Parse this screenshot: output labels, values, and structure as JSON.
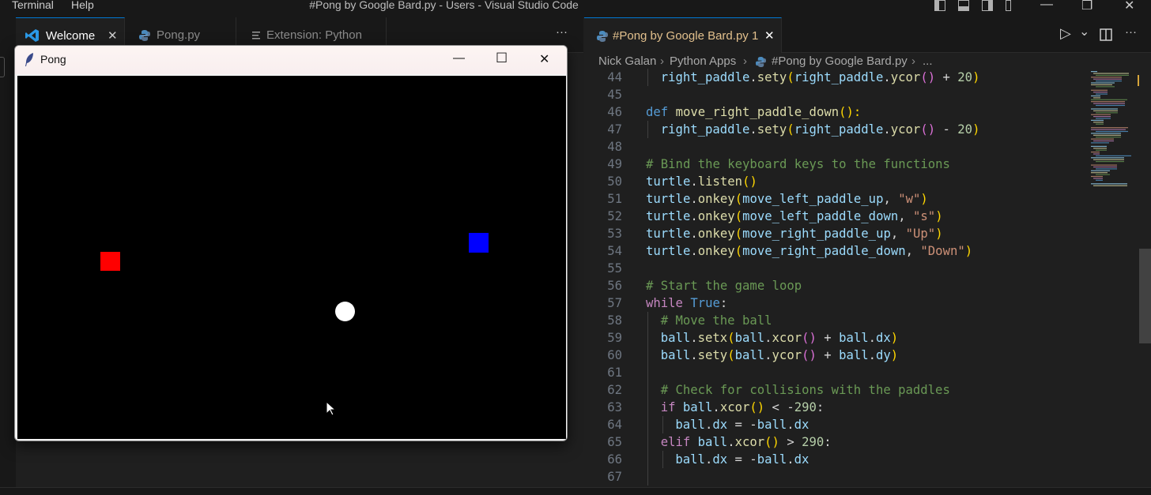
{
  "titlebar": {
    "menu": [
      "Terminal",
      "Help"
    ],
    "title": "#Pong by Google Bard.py - Users - Visual Studio Code",
    "controls": {
      "minimize": "—",
      "maximize": "❐",
      "close": "✕"
    }
  },
  "left_tabs": [
    {
      "label": "Welcome",
      "icon": "vscode-logo-icon",
      "close": "✕"
    },
    {
      "label": "Pong.py",
      "icon": "python-icon"
    },
    {
      "label": "Extension: Python",
      "icon": "extension-icon"
    }
  ],
  "left_more": "···",
  "pong_window": {
    "title": "Pong",
    "icon": "feather-icon",
    "controls": {
      "minimize": "—",
      "maximize": "☐",
      "close": "✕"
    },
    "colors": {
      "left_paddle": "#ff0000",
      "right_paddle": "#0000ff",
      "ball": "#ffffff",
      "background": "#000000"
    }
  },
  "right_tab": {
    "label": "#Pong by Google Bard.py",
    "badge": "1",
    "close": "✕",
    "icon": "python-icon"
  },
  "right_actions": {
    "run": "▷",
    "run_dropdown": "⌄",
    "split": "▯",
    "more": "···"
  },
  "breadcrumb": [
    "Nick Galan",
    "Python Apps",
    "#Pong by Google Bard.py",
    "..."
  ],
  "code_lines": [
    {
      "n": "44",
      "indent": 1,
      "tokens": [
        [
          "right_paddle",
          "var"
        ],
        [
          ".",
          "op"
        ],
        [
          "sety",
          "fn"
        ],
        [
          "(",
          "p1"
        ],
        [
          "right_paddle",
          "var"
        ],
        [
          ".",
          "op"
        ],
        [
          "ycor",
          "fn"
        ],
        [
          "()",
          "p2"
        ],
        [
          " + ",
          "op"
        ],
        [
          "20",
          "num"
        ],
        [
          ")",
          "p1"
        ]
      ]
    },
    {
      "n": "45",
      "indent": 0,
      "tokens": []
    },
    {
      "n": "46",
      "indent": 0,
      "tokens": [
        [
          "def ",
          "kw"
        ],
        [
          "move_right_paddle_down",
          "fn"
        ],
        [
          "():",
          "p1"
        ]
      ]
    },
    {
      "n": "47",
      "indent": 1,
      "tokens": [
        [
          "right_paddle",
          "var"
        ],
        [
          ".",
          "op"
        ],
        [
          "sety",
          "fn"
        ],
        [
          "(",
          "p1"
        ],
        [
          "right_paddle",
          "var"
        ],
        [
          ".",
          "op"
        ],
        [
          "ycor",
          "fn"
        ],
        [
          "()",
          "p2"
        ],
        [
          " - ",
          "op"
        ],
        [
          "20",
          "num"
        ],
        [
          ")",
          "p1"
        ]
      ]
    },
    {
      "n": "48",
      "indent": 0,
      "tokens": []
    },
    {
      "n": "49",
      "indent": 0,
      "tokens": [
        [
          "# Bind the keyboard keys to the functions",
          "com"
        ]
      ]
    },
    {
      "n": "50",
      "indent": 0,
      "tokens": [
        [
          "turtle",
          "var"
        ],
        [
          ".",
          "op"
        ],
        [
          "listen",
          "fn"
        ],
        [
          "()",
          "p1"
        ]
      ]
    },
    {
      "n": "51",
      "indent": 0,
      "tokens": [
        [
          "turtle",
          "var"
        ],
        [
          ".",
          "op"
        ],
        [
          "onkey",
          "fn"
        ],
        [
          "(",
          "p1"
        ],
        [
          "move_left_paddle_up",
          "var"
        ],
        [
          ", ",
          "op"
        ],
        [
          "\"w\"",
          "str"
        ],
        [
          ")",
          "p1"
        ]
      ]
    },
    {
      "n": "52",
      "indent": 0,
      "tokens": [
        [
          "turtle",
          "var"
        ],
        [
          ".",
          "op"
        ],
        [
          "onkey",
          "fn"
        ],
        [
          "(",
          "p1"
        ],
        [
          "move_left_paddle_down",
          "var"
        ],
        [
          ", ",
          "op"
        ],
        [
          "\"s\"",
          "str"
        ],
        [
          ")",
          "p1"
        ]
      ]
    },
    {
      "n": "53",
      "indent": 0,
      "tokens": [
        [
          "turtle",
          "var"
        ],
        [
          ".",
          "op"
        ],
        [
          "onkey",
          "fn"
        ],
        [
          "(",
          "p1"
        ],
        [
          "move_right_paddle_up",
          "var"
        ],
        [
          ", ",
          "op"
        ],
        [
          "\"Up\"",
          "str"
        ],
        [
          ")",
          "p1"
        ]
      ]
    },
    {
      "n": "54",
      "indent": 0,
      "tokens": [
        [
          "turtle",
          "var"
        ],
        [
          ".",
          "op"
        ],
        [
          "onkey",
          "fn"
        ],
        [
          "(",
          "p1"
        ],
        [
          "move_right_paddle_down",
          "var"
        ],
        [
          ", ",
          "op"
        ],
        [
          "\"Down\"",
          "str"
        ],
        [
          ")",
          "p1"
        ]
      ]
    },
    {
      "n": "55",
      "indent": 0,
      "tokens": []
    },
    {
      "n": "56",
      "indent": 0,
      "tokens": [
        [
          "# Start the game loop",
          "com"
        ]
      ]
    },
    {
      "n": "57",
      "indent": 0,
      "tokens": [
        [
          "while ",
          "ctl"
        ],
        [
          "True",
          "kw"
        ],
        [
          ":",
          "op"
        ]
      ]
    },
    {
      "n": "58",
      "indent": 1,
      "tokens": [
        [
          "# Move the ball",
          "com"
        ]
      ]
    },
    {
      "n": "59",
      "indent": 1,
      "tokens": [
        [
          "ball",
          "var"
        ],
        [
          ".",
          "op"
        ],
        [
          "setx",
          "fn"
        ],
        [
          "(",
          "p1"
        ],
        [
          "ball",
          "var"
        ],
        [
          ".",
          "op"
        ],
        [
          "xcor",
          "fn"
        ],
        [
          "()",
          "p2"
        ],
        [
          " + ",
          "op"
        ],
        [
          "ball",
          "var"
        ],
        [
          ".",
          "op"
        ],
        [
          "dx",
          "var"
        ],
        [
          ")",
          "p1"
        ]
      ]
    },
    {
      "n": "60",
      "indent": 1,
      "tokens": [
        [
          "ball",
          "var"
        ],
        [
          ".",
          "op"
        ],
        [
          "sety",
          "fn"
        ],
        [
          "(",
          "p1"
        ],
        [
          "ball",
          "var"
        ],
        [
          ".",
          "op"
        ],
        [
          "ycor",
          "fn"
        ],
        [
          "()",
          "p2"
        ],
        [
          " + ",
          "op"
        ],
        [
          "ball",
          "var"
        ],
        [
          ".",
          "op"
        ],
        [
          "dy",
          "var"
        ],
        [
          ")",
          "p1"
        ]
      ]
    },
    {
      "n": "61",
      "indent": 1,
      "tokens": []
    },
    {
      "n": "62",
      "indent": 1,
      "tokens": [
        [
          "# Check for collisions with the paddles",
          "com"
        ]
      ]
    },
    {
      "n": "63",
      "indent": 1,
      "tokens": [
        [
          "if ",
          "ctl"
        ],
        [
          "ball",
          "var"
        ],
        [
          ".",
          "op"
        ],
        [
          "xcor",
          "fn"
        ],
        [
          "()",
          "p1"
        ],
        [
          " < -",
          "op"
        ],
        [
          "290",
          "num"
        ],
        [
          ":",
          "op"
        ]
      ]
    },
    {
      "n": "64",
      "indent": 2,
      "tokens": [
        [
          "ball",
          "var"
        ],
        [
          ".",
          "op"
        ],
        [
          "dx",
          "var"
        ],
        [
          " = -",
          "op"
        ],
        [
          "ball",
          "var"
        ],
        [
          ".",
          "op"
        ],
        [
          "dx",
          "var"
        ]
      ]
    },
    {
      "n": "65",
      "indent": 1,
      "tokens": [
        [
          "elif ",
          "ctl"
        ],
        [
          "ball",
          "var"
        ],
        [
          ".",
          "op"
        ],
        [
          "xcor",
          "fn"
        ],
        [
          "()",
          "p1"
        ],
        [
          " > ",
          "op"
        ],
        [
          "290",
          "num"
        ],
        [
          ":",
          "op"
        ]
      ]
    },
    {
      "n": "66",
      "indent": 2,
      "tokens": [
        [
          "ball",
          "var"
        ],
        [
          ".",
          "op"
        ],
        [
          "dx",
          "var"
        ],
        [
          " = -",
          "op"
        ],
        [
          "ball",
          "var"
        ],
        [
          ".",
          "op"
        ],
        [
          "dx",
          "var"
        ]
      ]
    },
    {
      "n": "67",
      "indent": 1,
      "tokens": []
    }
  ]
}
